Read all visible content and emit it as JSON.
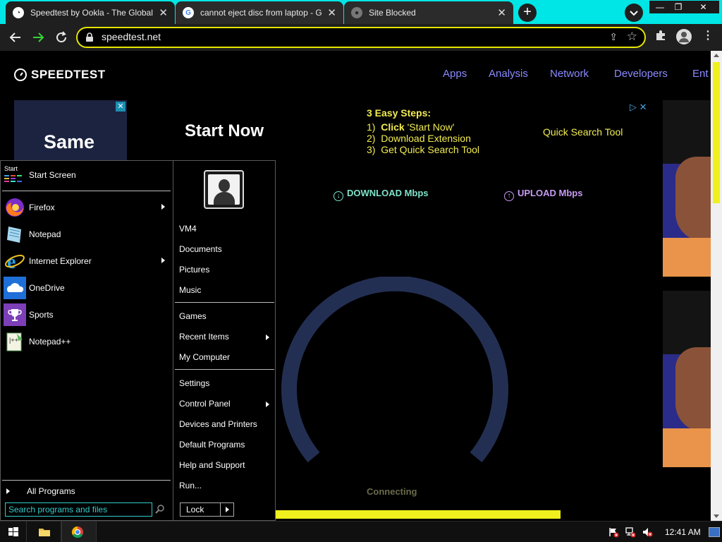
{
  "browser": {
    "tabs": [
      {
        "title": "Speedtest by Ookla - The Global",
        "active": true
      },
      {
        "title": "cannot eject disc from laptop - G",
        "active": false
      },
      {
        "title": "Site Blocked",
        "active": false
      }
    ],
    "url": "speedtest.net",
    "new_tab_symbol": "+",
    "window_buttons": {
      "minimize": "—",
      "restore": "❐",
      "close": "✕"
    }
  },
  "site": {
    "logo_text": "SPEEDTEST",
    "nav": [
      "Apps",
      "Analysis",
      "Network",
      "Developers",
      "Ent"
    ],
    "ad_left_text": "Same",
    "start_now": "Start Now",
    "steps": {
      "heading": "3 Easy Steps:",
      "step1_num": "1)",
      "step1_bold": "Click",
      "step1_rest": " 'Start Now'",
      "step2": "2)  Download Extension",
      "step3": "3)  Get Quick Search Tool"
    },
    "quick_search": "Quick Search Tool",
    "download_label": "DOWNLOAD Mbps",
    "upload_label": "UPLOAD Mbps",
    "status": "Connecting"
  },
  "start_menu": {
    "start_screen": "Start Screen",
    "start_tile_label": "Start",
    "programs": [
      {
        "label": "Firefox",
        "icon": "firefox-icon",
        "submenu": true
      },
      {
        "label": "Notepad",
        "icon": "notepad-icon",
        "submenu": false
      },
      {
        "label": "Internet Explorer",
        "icon": "internet-explorer-icon",
        "submenu": true
      },
      {
        "label": "OneDrive",
        "icon": "onedrive-icon",
        "submenu": false
      },
      {
        "label": "Sports",
        "icon": "trophy-icon",
        "submenu": false
      },
      {
        "label": "Notepad++",
        "icon": "notepad-plus-plus-icon",
        "submenu": false
      }
    ],
    "all_programs": "All Programs",
    "search_placeholder": "Search programs and files",
    "right": {
      "user_items": [
        "VM4",
        "Documents",
        "Pictures",
        "Music"
      ],
      "system_items": [
        "Games",
        "Recent Items",
        "My Computer"
      ],
      "settings_items": [
        "Settings",
        "Control Panel",
        "Devices and Printers",
        "Default Programs",
        "Help and Support",
        "Run..."
      ],
      "lock": "Lock"
    }
  },
  "taskbar": {
    "clock": "12:41 AM",
    "tray_icons": [
      "flag-error-icon",
      "network-error-icon",
      "volume-muted-icon"
    ]
  },
  "colors": {
    "tabstrip": "#00e5e5",
    "accent_yellow": "#f0f01e",
    "nav_purple": "#8a8aff",
    "download_teal": "#7fe3c9",
    "upload_purple": "#c79af5",
    "gauge_blue": "#232f52"
  }
}
